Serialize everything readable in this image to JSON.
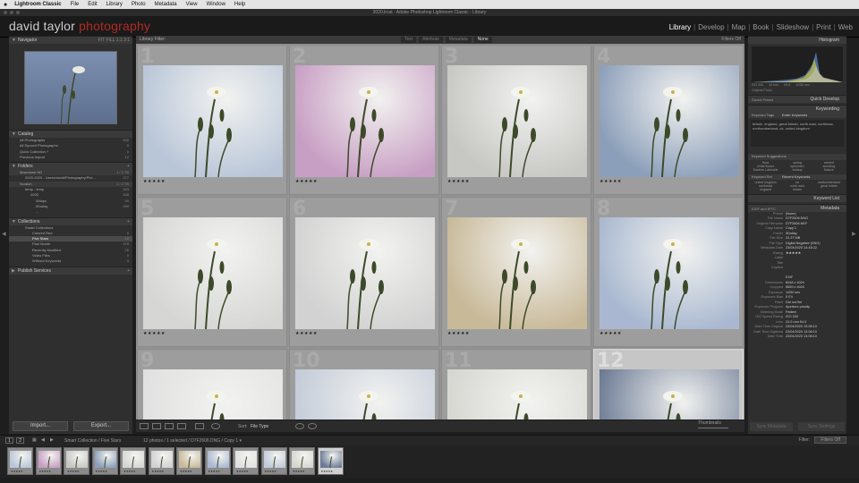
{
  "menubar": {
    "apple": "",
    "items": [
      "Lightroom Classic",
      "File",
      "Edit",
      "Library",
      "Photo",
      "Metadata",
      "View",
      "Window",
      "Help"
    ]
  },
  "window": {
    "title": "2020.lrcat - Adobe Photoshop Lightroom Classic - Library"
  },
  "identity": {
    "name_white": "david taylor",
    "name_red": "photography"
  },
  "modules": [
    "Library",
    "Develop",
    "Map",
    "Book",
    "Slideshow",
    "Print",
    "Web"
  ],
  "left": {
    "navigator": {
      "title": "Navigator",
      "zoom_options": "FIT  FILL  1:1  3:1"
    },
    "catalog": {
      "title": "Catalog",
      "items": [
        {
          "label": "All Photographs",
          "count": "630"
        },
        {
          "label": "All Synced Photographs",
          "count": "0"
        },
        {
          "label": "Quick Collection +",
          "count": "0"
        },
        {
          "label": "Previous Import",
          "count": "12"
        }
      ]
    },
    "folders": {
      "title": "Folders",
      "volumes": [
        {
          "label": "Macintosh HD",
          "count": "1 / 2 TB"
        },
        {
          "label": "2020-2020 - Users/david/Photography/Pict...",
          "count": "277"
        },
        {
          "label": "Scratch",
          "count": "1 / 2 TB"
        },
        {
          "label": "temp - temp",
          "count": "353"
        },
        {
          "label": "2020",
          "count": "348"
        },
        {
          "label": "0Maps",
          "count": "59"
        },
        {
          "label": "0Dollay",
          "count": "289"
        },
        {
          "label": "...",
          "count": ""
        }
      ]
    },
    "collections": {
      "title": "Collections",
      "items": [
        {
          "label": "Smart Collections",
          "count": ""
        },
        {
          "label": "Colored Red",
          "count": "0"
        },
        {
          "label": "Five Stars",
          "count": "12"
        },
        {
          "label": "Past Month",
          "count": "378"
        },
        {
          "label": "Recently Modified",
          "count": "26"
        },
        {
          "label": "Video Files",
          "count": "0"
        },
        {
          "label": "Without Keywords",
          "count": "4"
        }
      ]
    },
    "publish": {
      "title": "Publish Services"
    },
    "import_label": "Import...",
    "export_label": "Export..."
  },
  "filterbar": {
    "title": "Library Filter:",
    "tabs": [
      {
        "label": "Text"
      },
      {
        "label": "Attribute"
      },
      {
        "label": "Metadata"
      },
      {
        "label": "None",
        "active": true
      }
    ],
    "filters_off": "Filters Off"
  },
  "grid": {
    "cells": [
      {
        "idx": "1",
        "tint": "#b9c6d8",
        "stars": "★★★★★"
      },
      {
        "idx": "2",
        "tint": "#c89fc4",
        "stars": "★★★★★"
      },
      {
        "idx": "3",
        "tint": "#c7c7c4",
        "stars": "★★★★★"
      },
      {
        "idx": "4",
        "tint": "#8c9fba",
        "stars": "★★★★★"
      },
      {
        "idx": "5",
        "tint": "#d6d6d4",
        "stars": "★★★★★"
      },
      {
        "idx": "6",
        "tint": "#d2d2d2",
        "stars": "★★★★★"
      },
      {
        "idx": "7",
        "tint": "#c8b998",
        "stars": "★★★★★"
      },
      {
        "idx": "8",
        "tint": "#a9b8d0",
        "stars": "★★★★★"
      },
      {
        "idx": "9",
        "tint": "#e0e0e0",
        "stars": ""
      },
      {
        "idx": "10",
        "tint": "#c2cbd8",
        "stars": ""
      },
      {
        "idx": "11",
        "tint": "#d6d6d0",
        "stars": ""
      },
      {
        "idx": "12",
        "tint": "#6b7a94",
        "stars": "",
        "selected": true
      }
    ]
  },
  "toolbar": {
    "sort_label": "Sort:",
    "sort_value": "File Type",
    "thumb_label": "Thumbnails"
  },
  "filmstrip": {
    "page1": "1",
    "page2": "2",
    "path": "Smart Collection / Five Stars",
    "count": "12 photos / 1 selected / D7F2606.DNG / Copy 1 ▾",
    "filter_label": "Filter:",
    "filter_value": "Filters Off",
    "tints": [
      "#b9c6d8",
      "#c89fc4",
      "#c7c7c4",
      "#8c9fba",
      "#d6d6d4",
      "#d2d2d2",
      "#c8b998",
      "#a9b8d0",
      "#e0e0e0",
      "#c2cbd8",
      "#d6d6d0",
      "#6b7a94"
    ]
  },
  "right": {
    "histogram": {
      "title": "Histogram",
      "iso": "ISO 200",
      "focal": "34 mm",
      "aperture": "f/5.6",
      "shutter": "1/250 sec",
      "original_label": "Original Photo"
    },
    "quick_develop": {
      "title": "Quick Develop",
      "preset": "Saved Preset"
    },
    "keywording": {
      "title": "Keywording",
      "tags_label": "Keyword Tags",
      "tags_value": "Enter Keywords",
      "keywords": "britain, england, great britain, north east, northeast, northumberland, uk, united kingdom",
      "suggestions_title": "Keyword Suggestions",
      "suggestions": [
        "flora",
        "spring",
        "sterled",
        "white flower",
        "specimen",
        "seedling",
        "Eastern Lakeside",
        "botany",
        "Nature"
      ],
      "set_label": "Keyword Set",
      "set_value": "Recent Keywords",
      "recent": [
        "united kingdom",
        "uk",
        "northumberland",
        "northeast",
        "north east",
        "great britain",
        "england",
        "britain",
        ""
      ]
    },
    "keyword_list": {
      "title": "Keyword List"
    },
    "metadata": {
      "title": "Metadata",
      "preset_label": "Preset",
      "preset_value": "(None)",
      "top_value": "EXIF and IPTC",
      "rows": [
        {
          "k": "File Name",
          "v": "D7F2606.DNG"
        },
        {
          "k": "Original Filename",
          "v": "D7F2606.NEF"
        },
        {
          "k": "Copy Name",
          "v": "Copy 1"
        },
        {
          "k": "Folder",
          "v": "0Dollay"
        },
        {
          "k": "File Size",
          "v": "22.37 MB"
        },
        {
          "k": "File Type",
          "v": "Digital Negative (DNG)"
        },
        {
          "k": "Metadata Date",
          "v": "23/04/2020 14:48:22"
        },
        {
          "k": "Rating",
          "v": "★★★★★"
        },
        {
          "k": "Label",
          "v": ""
        },
        {
          "k": "Title",
          "v": ""
        },
        {
          "k": "Caption",
          "v": ""
        },
        {
          "k": "",
          "v": ""
        },
        {
          "k": "",
          "v": "EXIF"
        },
        {
          "k": "Dimensions",
          "v": "6048 x 4024"
        },
        {
          "k": "Cropped",
          "v": "5659 x 4024"
        },
        {
          "k": "Exposure",
          "v": "1/250 sec"
        },
        {
          "k": "Exposure Bias",
          "v": "0 EV"
        },
        {
          "k": "Flash",
          "v": "Did not fire"
        },
        {
          "k": "Exposure Program",
          "v": "Aperture priority"
        },
        {
          "k": "Metering Mode",
          "v": "Pattern"
        },
        {
          "k": "ISO Speed Rating",
          "v": "ISO 200"
        },
        {
          "k": "Lens",
          "v": "24.0 mm f/4.0"
        },
        {
          "k": "Date Time Original",
          "v": "23/04/2020 13:08:10"
        },
        {
          "k": "Date Time Digitized",
          "v": "23/04/2020 13:08:10"
        },
        {
          "k": "Date Time",
          "v": "23/04/2020 13:08:10"
        }
      ]
    },
    "sync_metadata": "Sync Metadata",
    "sync_settings": "Sync Settings"
  }
}
